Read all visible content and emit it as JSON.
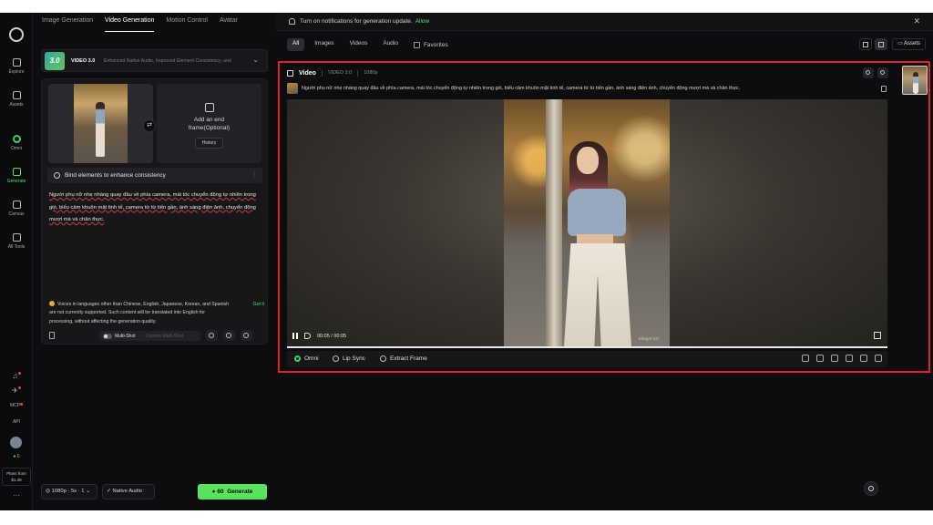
{
  "rail": {
    "items": [
      {
        "label": "Explore"
      },
      {
        "label": "Assets"
      },
      {
        "label": "Omni"
      },
      {
        "label": "Generate"
      },
      {
        "label": "Canvas"
      },
      {
        "label": "All Tools"
      }
    ],
    "mcp": "MCP",
    "api": "API",
    "credits": "6",
    "plans_label": "Plans from",
    "plans_price": "$1.49",
    "more": "···"
  },
  "panel": {
    "tabs": [
      "Image Generation",
      "Video Generation",
      "Motion Control",
      "Avatar"
    ],
    "active_tab": "Video Generation",
    "model": {
      "badge": "3.0",
      "name": "VIDEO 3.0",
      "description": "Enhanced Native Audio, Improved Element Consistency, and"
    },
    "end_frame": {
      "label_line1": "Add an end",
      "label_line2": "frame(Optional)",
      "history": "History"
    },
    "bind_label": "Bind elements to enhance consistency",
    "prompt_text": "Người phụ nữ nhẹ nhàng quay đầu về phía camera, mái tóc chuyển động tự nhiên trong gió, biểu cảm khuôn mặt tinh tế, camera từ từ tiến gần, ánh sáng điện ảnh, chuyển động mượt mà và chân thực.",
    "warning": {
      "line1": "Voices in languages other than Chinese, English, Japanese, Korean, and Spanish",
      "line2": "are not currently supported. Such content will be translated into English for",
      "line3": "processing, without affecting the generation quality.",
      "got_it": "Got it"
    },
    "multishot": {
      "label": "Multi-Shot",
      "custom": "Custom Multi-Shot"
    },
    "bottom": {
      "resolution": "1080p",
      "duration": "5s",
      "count": "1",
      "native_audio": "Native Audio",
      "generate_cost": "60",
      "generate_label": "Generate"
    }
  },
  "main": {
    "notification": {
      "text": "Turn on notifications for generation update.",
      "allow": "Allow"
    },
    "filters": [
      "All",
      "Images",
      "Videos",
      "Audio"
    ],
    "active_filter": "All",
    "favorites": "Favorites",
    "assets_button": "Assets",
    "result": {
      "type_label": "Video",
      "model": "VIDEO 3.0",
      "resolution": "1080p",
      "prompt": "Người phụ nữ nhẹ nhàng quay đầu về phía camera, mái tóc chuyển động tự nhiên trong gió, biểu cảm khuôn mặt tinh tế, camera từ từ tiến gần, ánh sáng điện ảnh, chuyển động mượt mà và chân thực.",
      "time": "00:05 / 00:05",
      "watermark": "KlingAI 3.0",
      "progress": 1.0,
      "tools": [
        "Omni",
        "Lip Sync",
        "Extract Frame"
      ]
    }
  },
  "colors": {
    "accent": "#4be07a",
    "generate": "#57e35c",
    "highlight_border": "#e0202a"
  }
}
